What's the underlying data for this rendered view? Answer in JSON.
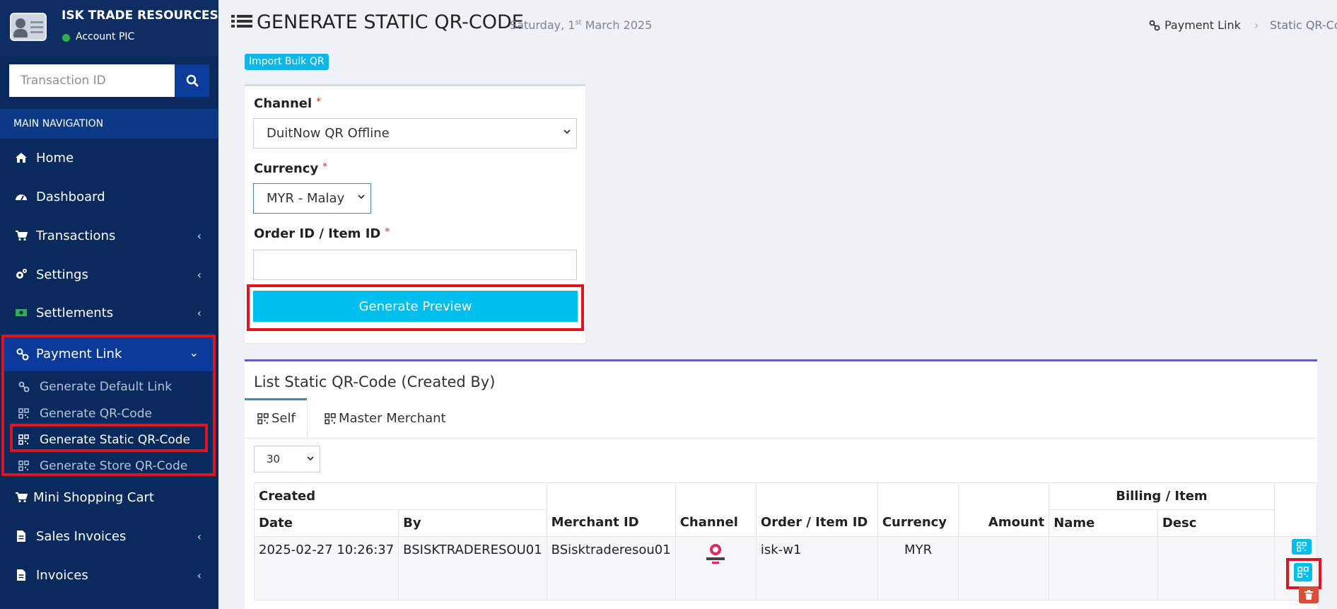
{
  "sidebar": {
    "company": "ISK TRADE RESOURCES",
    "account": "Account PIC",
    "search_placeholder": "Transaction ID",
    "nav_header": "MAIN NAVIGATION",
    "items": [
      {
        "label": "Home"
      },
      {
        "label": "Dashboard"
      },
      {
        "label": "Transactions"
      },
      {
        "label": "Settings"
      },
      {
        "label": "Settlements"
      },
      {
        "label": "Payment Link"
      },
      {
        "label": "Mini Shopping Cart"
      },
      {
        "label": "Sales Invoices"
      },
      {
        "label": "Invoices"
      }
    ],
    "payment_link_sub": [
      {
        "label": "Generate Default Link"
      },
      {
        "label": "Generate QR-Code"
      },
      {
        "label": "Generate Static QR-Code"
      },
      {
        "label": "Generate Store QR-Code"
      }
    ]
  },
  "header": {
    "title": "GENERATE STATIC QR-CODE",
    "date_prefix": "Saturday, 1",
    "date_sup": "st",
    "date_suffix": " March 2025",
    "breadcrumb": [
      "Payment Link",
      "Static QR-Code"
    ]
  },
  "form": {
    "import_button": "Import Bulk QR",
    "channel_label": "Channel",
    "channel_value": "DuitNow QR Offline",
    "currency_label": "Currency",
    "currency_value": "MYR - Malay",
    "order_label": "Order ID / Item ID",
    "order_value": "",
    "required_mark": "*",
    "generate_button": "Generate Preview"
  },
  "list": {
    "title": "List Static QR-Code (Created By)",
    "tabs": [
      "Self",
      "Master Merchant"
    ],
    "page_size": "30",
    "headers": {
      "created": "Created",
      "billing_item": "Billing / Item",
      "date": "Date",
      "by": "By",
      "merchant_id": "Merchant ID",
      "channel": "Channel",
      "order_item_id": "Order / Item ID",
      "currency": "Currency",
      "amount": "Amount",
      "name": "Name",
      "desc": "Desc"
    },
    "rows": [
      {
        "date": "2025-02-27 10:26:37",
        "by": "BSISKTRADERESOU01",
        "merchant_id": "BSisktraderesou01",
        "channel_logo": "duitnow-qr-logo",
        "order_item_id": "isk-w1",
        "currency": "MYR",
        "amount": "",
        "name": "",
        "desc": ""
      }
    ]
  },
  "colors": {
    "sidebar_bg": "#0a2a5e",
    "accent_cyan": "#00bfee",
    "highlight_red": "#e0141f",
    "active_blue": "#0b3a9b"
  }
}
